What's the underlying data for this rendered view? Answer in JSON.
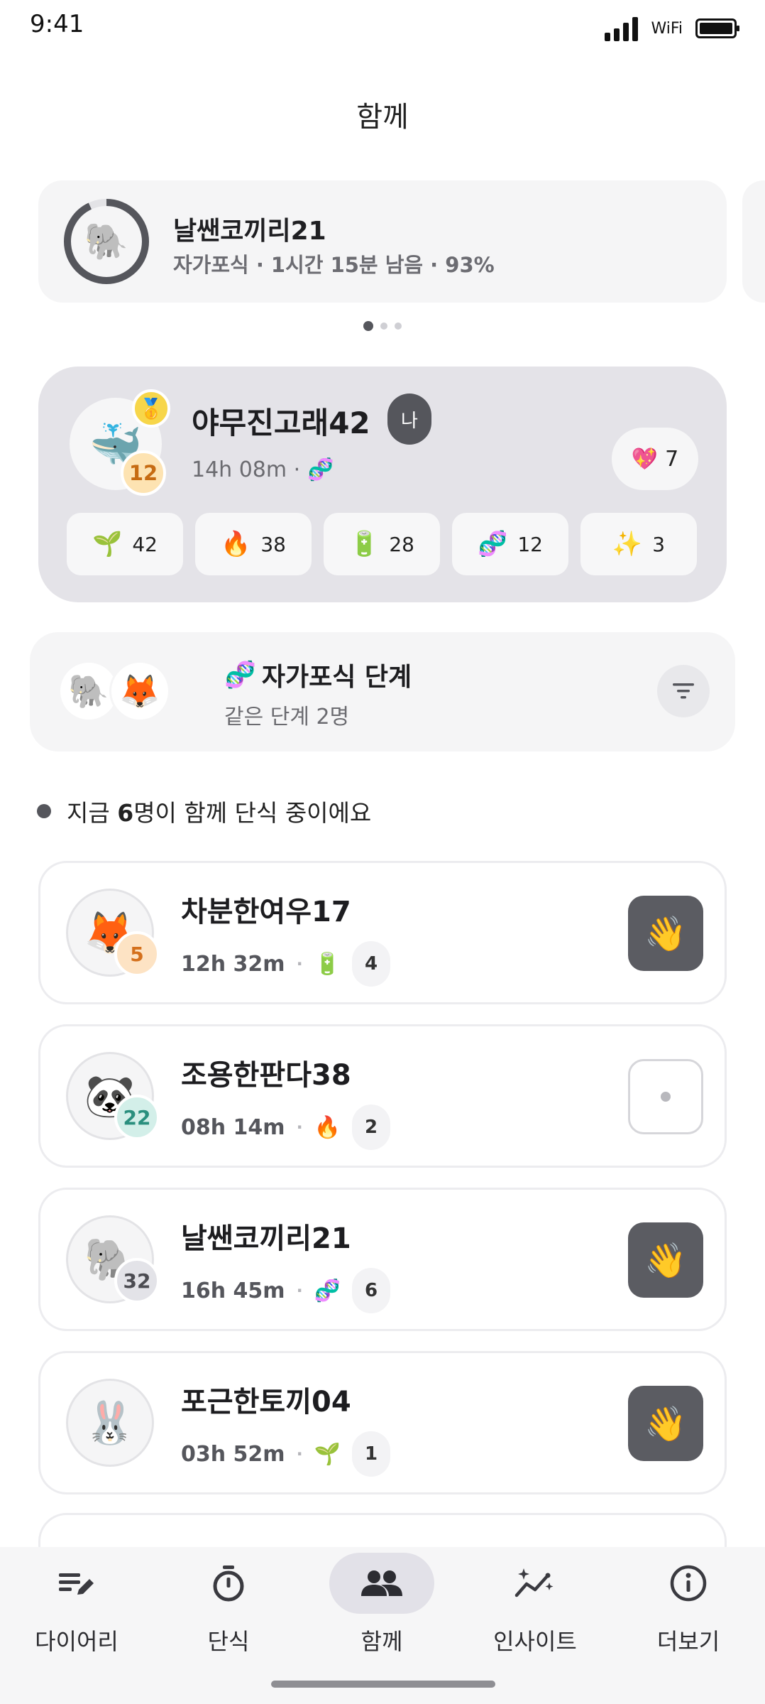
{
  "status": {
    "time": "9:41",
    "wifi": "WiFi"
  },
  "page": {
    "title": "함께"
  },
  "session": {
    "emoji": "🐘",
    "progress": 0.93,
    "name": "날쌘코끼리21",
    "subtitle": "자가포식 · 1시간 15분 남음 · 93%"
  },
  "carousel": {
    "count": 3,
    "active": 0
  },
  "me": {
    "emoji": "🐳",
    "medal": "🥇",
    "level": "12",
    "name": "야무진고래42",
    "tag": "나",
    "time": "14h 08m ·",
    "stage_icon": "🧬",
    "hearts_icon": "💖",
    "hearts": "7",
    "stats": [
      {
        "icon": "🌱",
        "value": "42"
      },
      {
        "icon": "🔥",
        "value": "38"
      },
      {
        "icon": "🔋",
        "value": "28"
      },
      {
        "icon": "🧬",
        "value": "12"
      },
      {
        "icon": "✨",
        "value": "3"
      }
    ]
  },
  "stage": {
    "avatars": [
      "🐘",
      "🦊"
    ],
    "icon": "🧬",
    "title": "자가포식 단계",
    "subtitle": "같은 단계 2명"
  },
  "live": {
    "prefix": "지금 ",
    "count": "6",
    "suffix": "명이 함께 단식 중이에요"
  },
  "users": [
    {
      "emoji": "🦊",
      "level": "5",
      "level_bg": "#fde3c4",
      "level_fg": "#d4701c",
      "name": "차분한여우17",
      "time": "12h 32m",
      "stage_icon": "🔋",
      "count": "4",
      "wave": true,
      "wave_icon": "👋"
    },
    {
      "emoji": "🐼",
      "level": "22",
      "level_bg": "#d3efe9",
      "level_fg": "#2a8f7e",
      "name": "조용한판다38",
      "time": "08h 14m",
      "stage_icon": "🔥",
      "count": "2",
      "wave": false,
      "wave_icon": ""
    },
    {
      "emoji": "🐘",
      "level": "32",
      "level_bg": "#e3e3e8",
      "level_fg": "#4c4c52",
      "name": "날쌘코끼리21",
      "time": "16h 45m",
      "stage_icon": "🧬",
      "count": "6",
      "wave": true,
      "wave_icon": "👋"
    },
    {
      "emoji": "🐰",
      "level": "",
      "level_bg": "",
      "level_fg": "",
      "name": "포근한토끼04",
      "time": "03h 52m",
      "stage_icon": "🌱",
      "count": "1",
      "wave": true,
      "wave_icon": "👋"
    }
  ],
  "tabs": [
    {
      "id": "diary",
      "label": "다이어리",
      "icon": "diary-edit-icon"
    },
    {
      "id": "fasting",
      "label": "단식",
      "icon": "timer-icon"
    },
    {
      "id": "together",
      "label": "함께",
      "icon": "people-icon",
      "active": true
    },
    {
      "id": "insight",
      "label": "인사이트",
      "icon": "insight-chart-icon"
    },
    {
      "id": "more",
      "label": "더보기",
      "icon": "info-icon"
    }
  ],
  "colors": {
    "accent_dark": "#55565c",
    "card_bg": "#f5f5f6",
    "me_card_bg": "#e4e3e8"
  }
}
